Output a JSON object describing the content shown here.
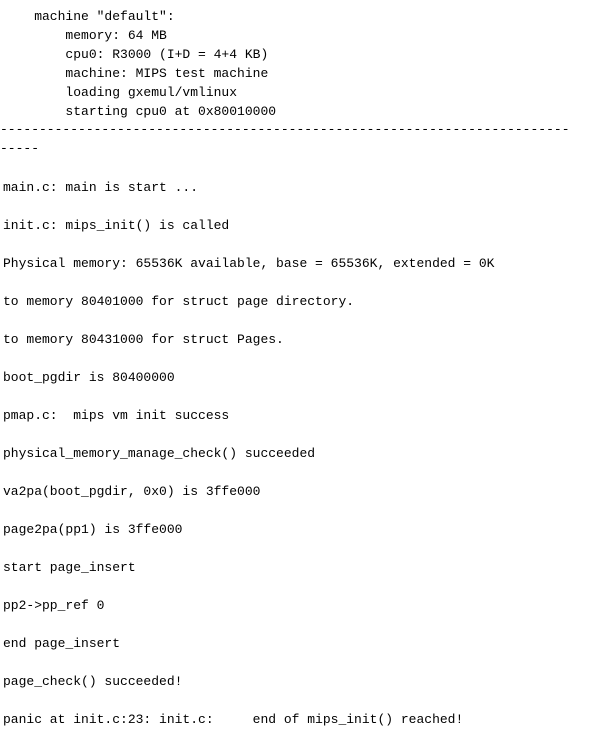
{
  "terminal": {
    "text_color": "#000000",
    "background_color": "#ffffff",
    "lines": [
      "    machine \"default\":",
      "        memory: 64 MB",
      "        cpu0: R3000 (I+D = 4+4 KB)",
      "        machine: MIPS test machine",
      "        loading gxemul/vmlinux",
      "        starting cpu0 at 0x80010000",
      "-------------------------------------------------------------------------",
      "-----",
      "main.c: main is start ...",
      "init.c: mips_init() is called",
      "Physical memory: 65536K available, base = 65536K, extended = 0K",
      "to memory 80401000 for struct page directory.",
      "to memory 80431000 for struct Pages.",
      "boot_pgdir is 80400000",
      "pmap.c:  mips vm init success",
      "physical_memory_manage_check() succeeded",
      "va2pa(boot_pgdir, 0x0) is 3ffe000",
      "page2pa(pp1) is 3ffe000",
      "start page_insert",
      "pp2->pp_ref 0",
      "end page_insert",
      "page_check() succeeded!",
      "panic at init.c:23: init.c:     end of mips_init() reached!"
    ]
  }
}
